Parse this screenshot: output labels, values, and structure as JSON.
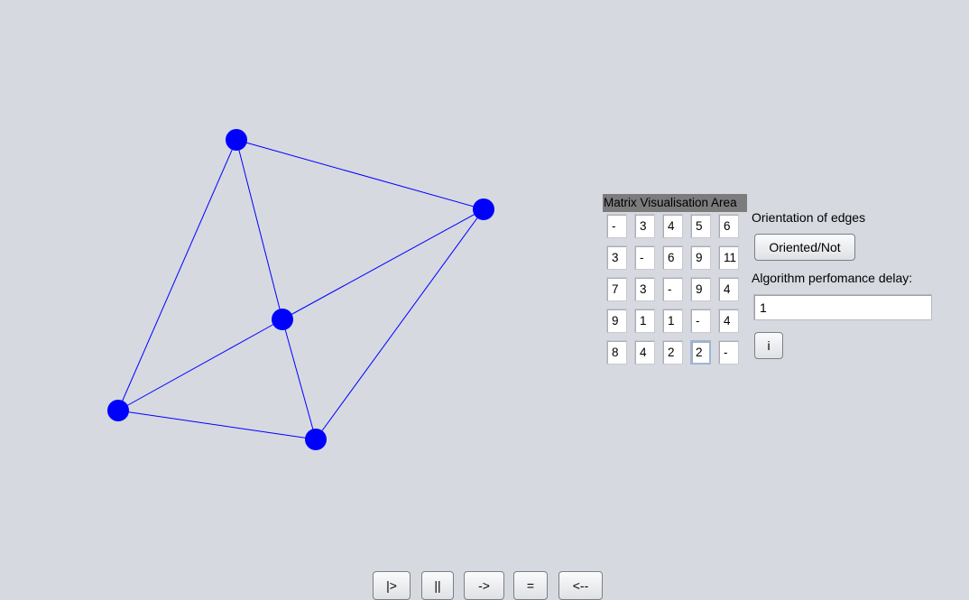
{
  "graph": {
    "vertex_color": "#0000ff",
    "edge_color": "#0000ff",
    "vertices": [
      {
        "id": 0
      },
      {
        "id": 1
      },
      {
        "id": 2
      },
      {
        "id": 3
      },
      {
        "id": 4
      }
    ],
    "edges": [
      [
        0,
        1
      ],
      [
        0,
        2
      ],
      [
        0,
        3
      ],
      [
        1,
        2
      ],
      [
        1,
        4
      ],
      [
        2,
        3
      ],
      [
        2,
        4
      ],
      [
        3,
        4
      ]
    ]
  },
  "matrix": {
    "title": "Matrix Visualisation Area",
    "rows": [
      [
        "-",
        "3",
        "4",
        "5",
        "6"
      ],
      [
        "3",
        "-",
        "6",
        "9",
        "11"
      ],
      [
        "7",
        "3",
        "-",
        "9",
        "4"
      ],
      [
        "9",
        "1",
        "1",
        "-",
        "4"
      ],
      [
        "8",
        "4",
        "2",
        "2",
        "-"
      ]
    ],
    "focused_cell": [
      4,
      3
    ]
  },
  "controls": {
    "orientation_label": "Orientation of edges",
    "orientation_button": "Oriented/Not",
    "delay_label": "Algorithm perfomance delay:",
    "delay_value": "1",
    "info_button": "i"
  },
  "toolbar": {
    "play": "|>",
    "pause": "||",
    "step": "->",
    "equals": "=",
    "back": "<--"
  }
}
